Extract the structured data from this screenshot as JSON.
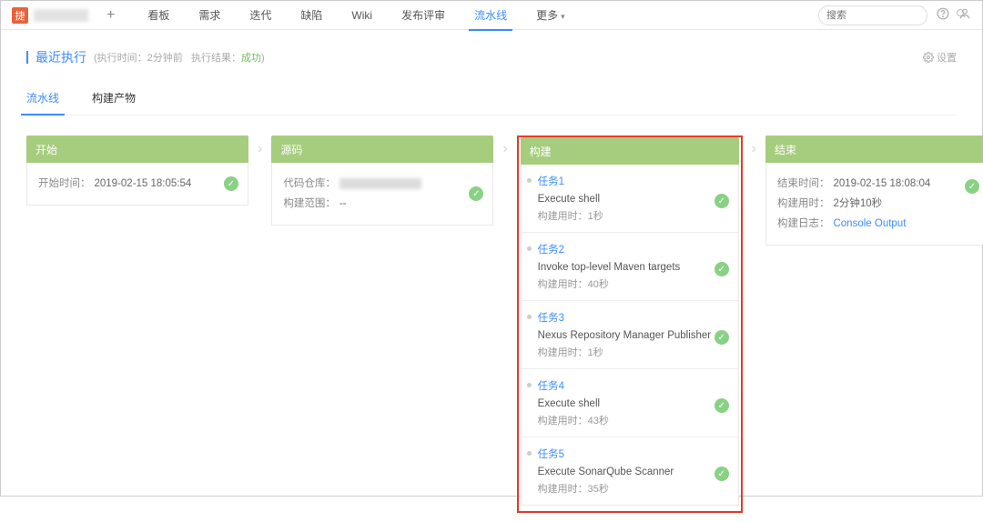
{
  "topnav": {
    "logo_char": "捷",
    "add_icon": "+",
    "tabs": [
      "看板",
      "需求",
      "迭代",
      "缺陷",
      "Wiki",
      "发布评审",
      "流水线",
      "更多"
    ],
    "active_tab_index": 6,
    "search_placeholder": "搜索"
  },
  "header": {
    "title": "最近执行",
    "run_time_label": "执行时间：",
    "run_time_value": "2分钟前",
    "result_label": "执行结果：",
    "result_value": "成功",
    "settings": "设置"
  },
  "subtabs": [
    "流水线",
    "构建产物"
  ],
  "subtabs_active": 0,
  "stages": {
    "start_title": "开始",
    "source_title": "源码",
    "build_title": "构建",
    "end_title": "结束"
  },
  "start": {
    "start_time_label": "开始时间：",
    "start_time_value": "2019-02-15 18:05:54"
  },
  "source": {
    "repo_label": "代码仓库：",
    "scope_label": "构建范围：",
    "scope_value": "--"
  },
  "build_tasks": [
    {
      "name": "任务1",
      "desc": "Execute shell",
      "time_label": "构建用时：",
      "time_value": "1秒"
    },
    {
      "name": "任务2",
      "desc": "Invoke top-level Maven targets",
      "time_label": "构建用时：",
      "time_value": "40秒"
    },
    {
      "name": "任务3",
      "desc": "Nexus Repository Manager Publisher",
      "time_label": "构建用时：",
      "time_value": "1秒"
    },
    {
      "name": "任务4",
      "desc": "Execute shell",
      "time_label": "构建用时：",
      "time_value": "43秒"
    },
    {
      "name": "任务5",
      "desc": "Execute SonarQube Scanner",
      "time_label": "构建用时：",
      "time_value": "35秒"
    }
  ],
  "end": {
    "end_time_label": "结束时间：",
    "end_time_value": "2019-02-15 18:08:04",
    "duration_label": "构建用时：",
    "duration_value": "2分钟10秒",
    "log_label": "构建日志：",
    "log_link": "Console Output"
  }
}
